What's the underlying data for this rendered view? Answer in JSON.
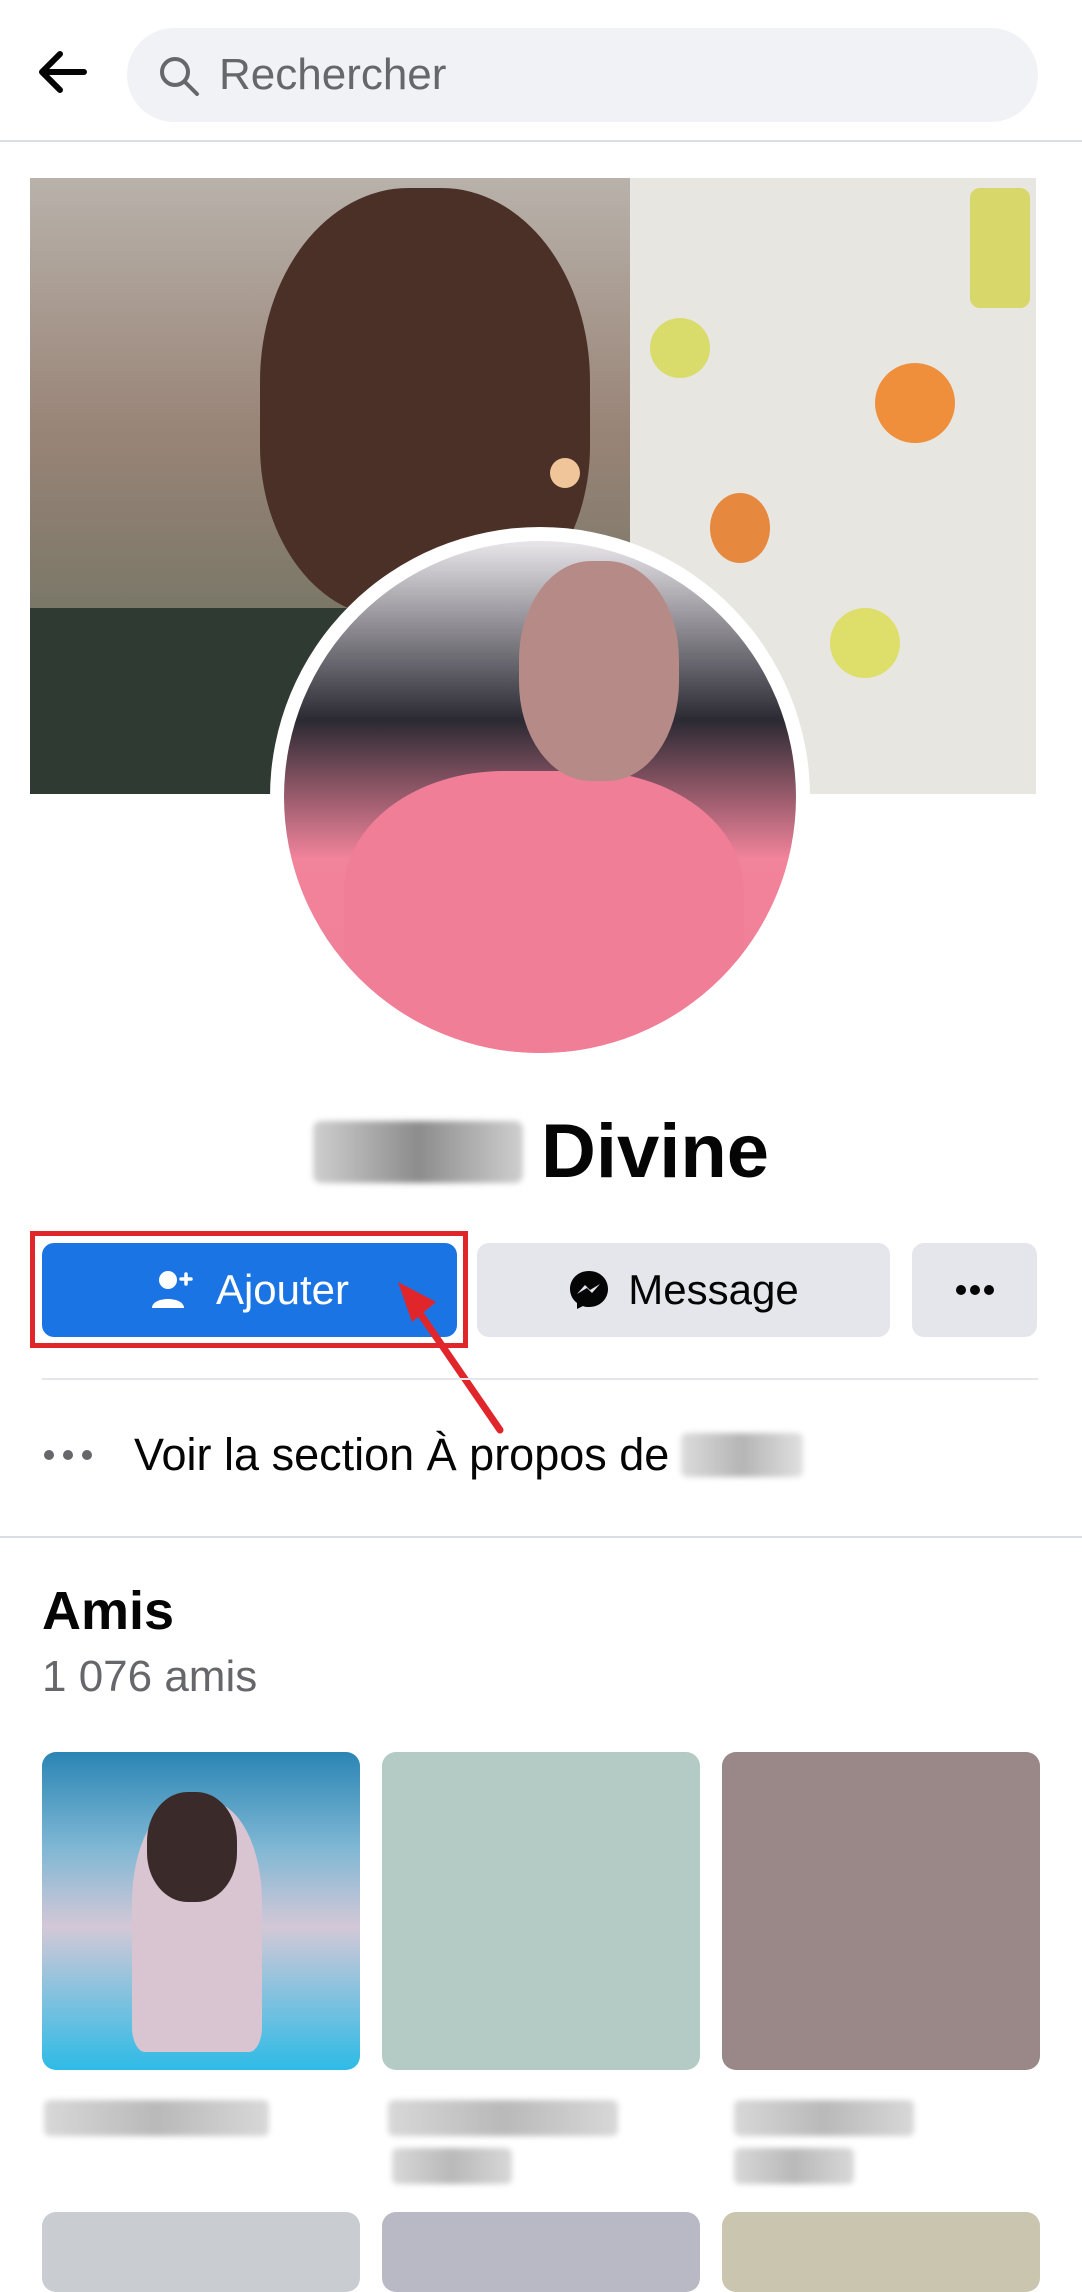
{
  "search": {
    "placeholder": "Rechercher"
  },
  "profile": {
    "last_name": "Divine"
  },
  "actions": {
    "add_label": "Ajouter",
    "message_label": "Message"
  },
  "about": {
    "text": "Voir la section À propos de"
  },
  "friends": {
    "title": "Amis",
    "count": "1 076 amis"
  },
  "icons": {
    "back": "arrow-left-icon",
    "search": "search-icon",
    "add_friend": "person-add-icon",
    "messenger": "messenger-icon",
    "more": "more-horizontal-icon",
    "about_dots": "more-horizontal-icon"
  },
  "colors": {
    "primary": "#1b74e4",
    "highlight": "#e0262b",
    "secondary_button": "#e4e6eb",
    "muted_text": "#65676b"
  }
}
